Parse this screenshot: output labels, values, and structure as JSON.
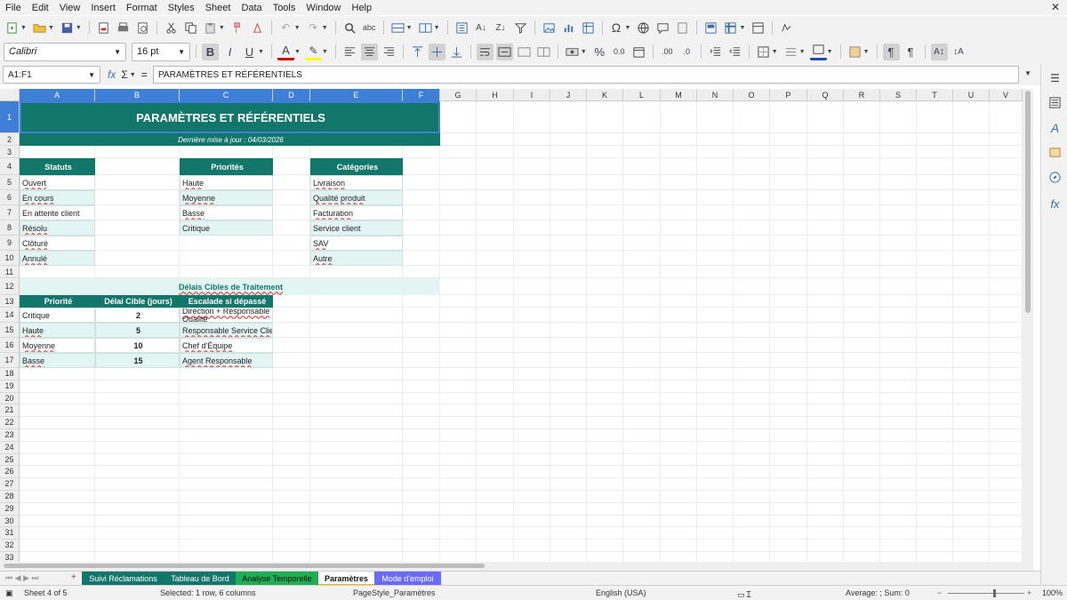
{
  "menu": [
    "File",
    "Edit",
    "View",
    "Insert",
    "Format",
    "Styles",
    "Sheet",
    "Data",
    "Tools",
    "Window",
    "Help"
  ],
  "menu_close": "✕",
  "font_name": "Calibri",
  "font_size": "16 pt",
  "name_box": "A1:F1",
  "formula_content": "PARAMÈTRES ET RÉFÉRENTIELS",
  "columns": [
    "A",
    "B",
    "C",
    "D",
    "E",
    "F",
    "G",
    "H",
    "I",
    "J",
    "K",
    "L",
    "M",
    "N",
    "O",
    "P",
    "Q",
    "R",
    "S",
    "T",
    "U",
    "V"
  ],
  "rows": [
    "1",
    "2",
    "3",
    "4",
    "5",
    "6",
    "7",
    "8",
    "9",
    "10",
    "11",
    "12",
    "13",
    "14",
    "15",
    "16",
    "17",
    "18",
    "19",
    "20",
    "21",
    "22",
    "23",
    "24",
    "25",
    "26",
    "27",
    "28",
    "29",
    "30",
    "31",
    "32",
    "33"
  ],
  "sheet": {
    "title": "PARAMÈTRES ET RÉFÉRENTIELS",
    "subtitle": "Dernière mise à jour : 04/03/2026",
    "statuts_header": "Statuts",
    "statuts": [
      "Ouvert",
      "En cours",
      "En attente client",
      "Résolu",
      "Clôturé",
      "Annulé"
    ],
    "priorites_header": "Priorités",
    "priorites": [
      "Haute",
      "Moyenne",
      "Basse",
      "Critique"
    ],
    "categories_header": "Catégories",
    "categories": [
      "Livraison",
      "Qualité produit",
      "Facturation",
      "Service client",
      "SAV",
      "Autre"
    ],
    "delais_title": "Délais Cibles de Traitement",
    "delais_headers": [
      "Priorité",
      "Délai Cible (jours)",
      "Escalade si dépassé"
    ],
    "delais_rows": [
      [
        "Critique",
        "2",
        "Direction + Responsable Qualité"
      ],
      [
        "Haute",
        "5",
        "Responsable Service Client"
      ],
      [
        "Moyenne",
        "10",
        "Chef d'Équipe"
      ],
      [
        "Basse",
        "15",
        "Agent Responsable"
      ]
    ]
  },
  "tabs": [
    "Suivi Réclamations",
    "Tableau de Bord",
    "Analyse Temporelle",
    "Paramètres",
    "Mode d'emploi"
  ],
  "tab_add": "+",
  "status": {
    "sheet": "Sheet 4 of 5",
    "selection": "Selected: 1 row, 6 columns",
    "pagestyle": "PageStyle_Paramètres",
    "language": "English (USA)",
    "sum": "Average: ; Sum: 0",
    "zoom": "100%"
  },
  "colors": {
    "teal": "#13766b",
    "light": "#e3f5f3",
    "tab_blue": "#6a6aff",
    "tab_green": "#1fae55",
    "tab_teal": "#13766b"
  }
}
